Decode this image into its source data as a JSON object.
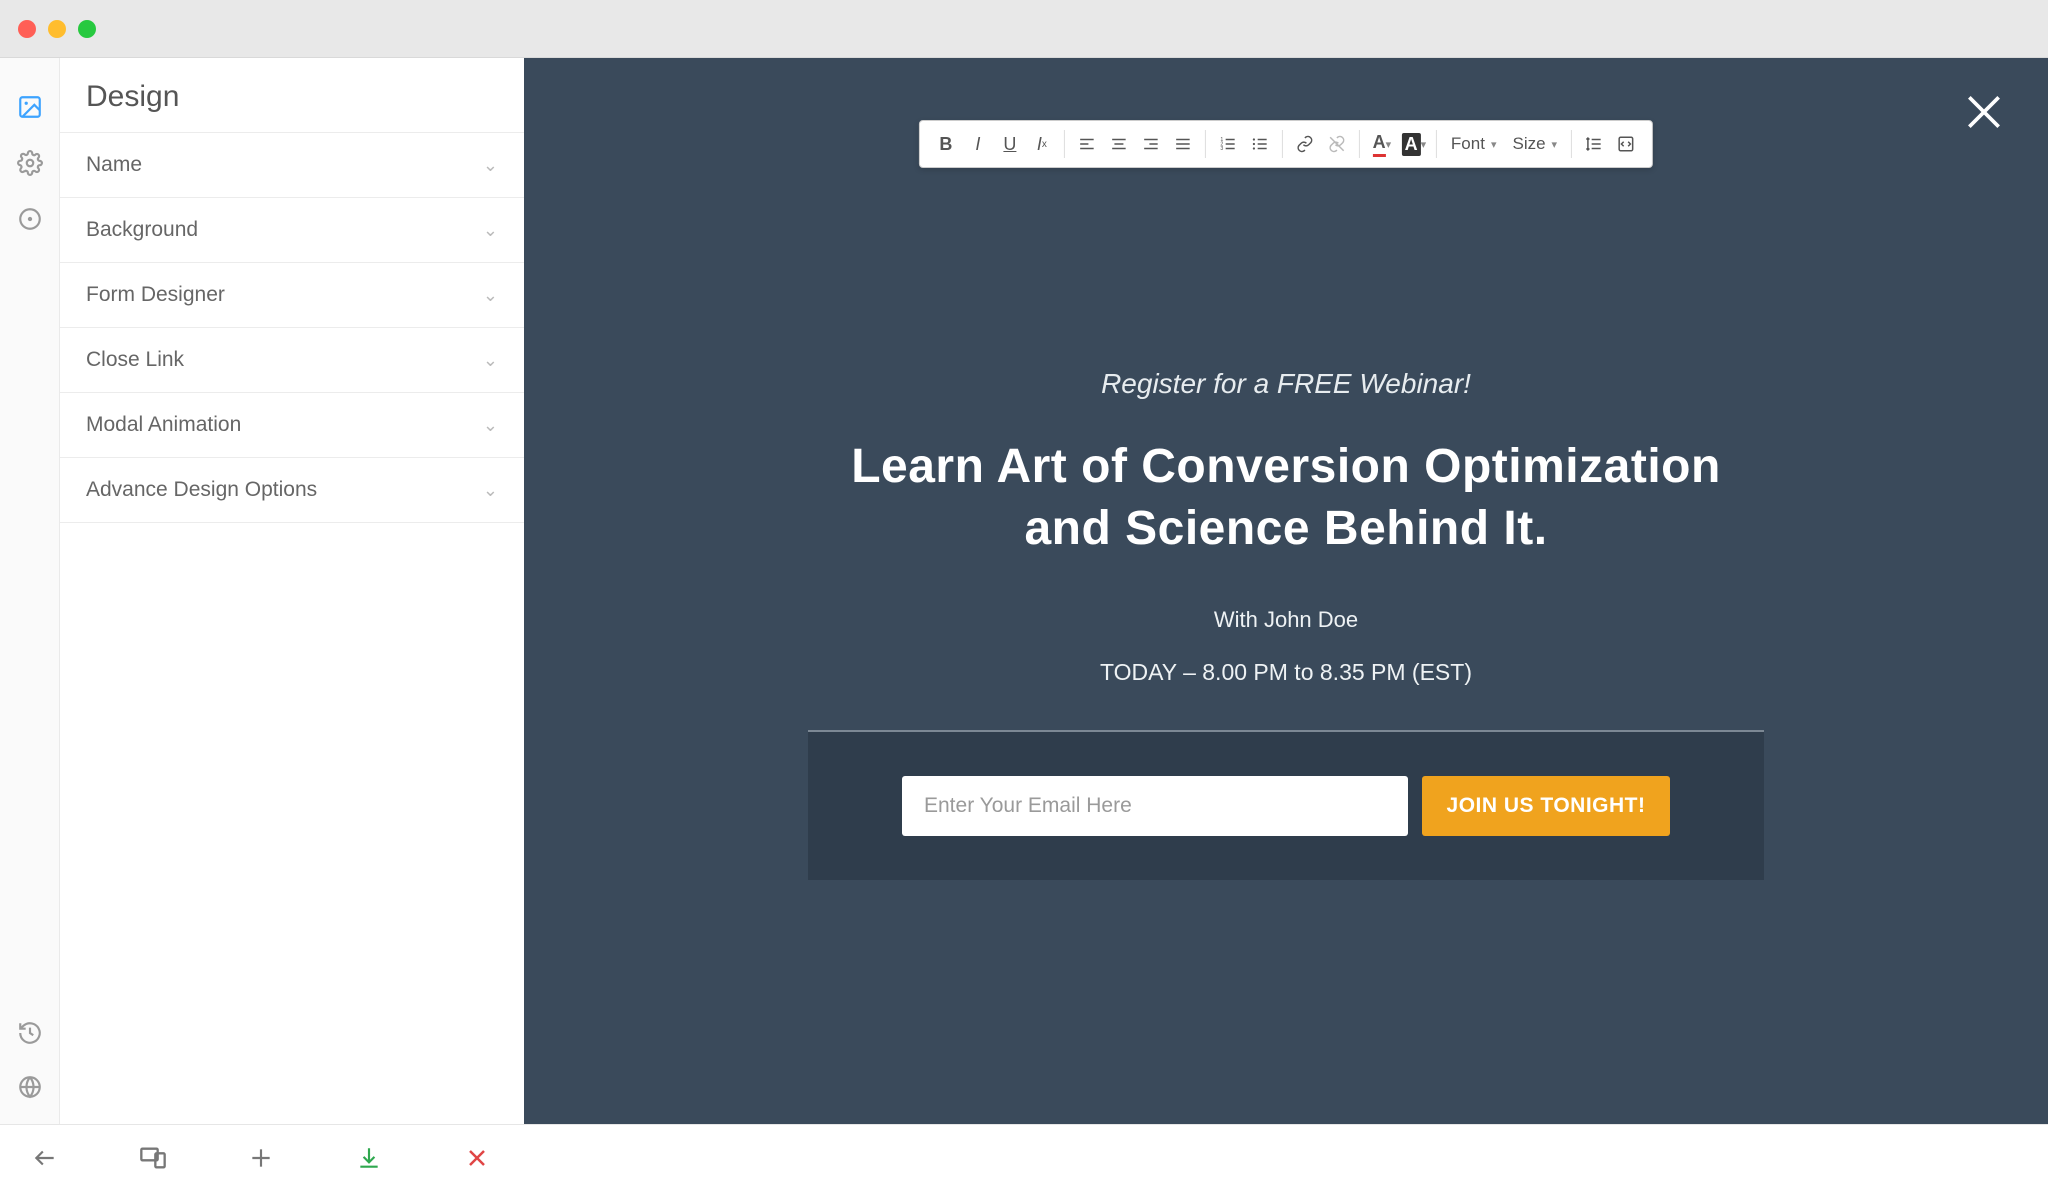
{
  "sidebar": {
    "title": "Design",
    "items": [
      {
        "label": "Name"
      },
      {
        "label": "Background"
      },
      {
        "label": "Form Designer"
      },
      {
        "label": "Close Link"
      },
      {
        "label": "Modal Animation"
      },
      {
        "label": "Advance Design Options"
      }
    ]
  },
  "rail_icons": {
    "image": "image-icon",
    "settings": "gear-icon",
    "target": "target-icon",
    "history": "history-icon",
    "globe": "globe-icon"
  },
  "rte": {
    "font_label": "Font",
    "size_label": "Size"
  },
  "modal": {
    "eyebrow": "Register for a FREE Webinar!",
    "headline": "Learn Art of Conversion Optimization and Science Behind It.",
    "presenter": "With John Doe",
    "timing": "TODAY – 8.00 PM to 8.35 PM (EST)",
    "email_placeholder": "Enter Your Email Here",
    "cta_label": "JOIN US TONIGHT!"
  },
  "bottom": {
    "back": "back-icon",
    "devices": "devices-icon",
    "add": "plus-icon",
    "download": "download-icon",
    "close": "close-icon"
  }
}
